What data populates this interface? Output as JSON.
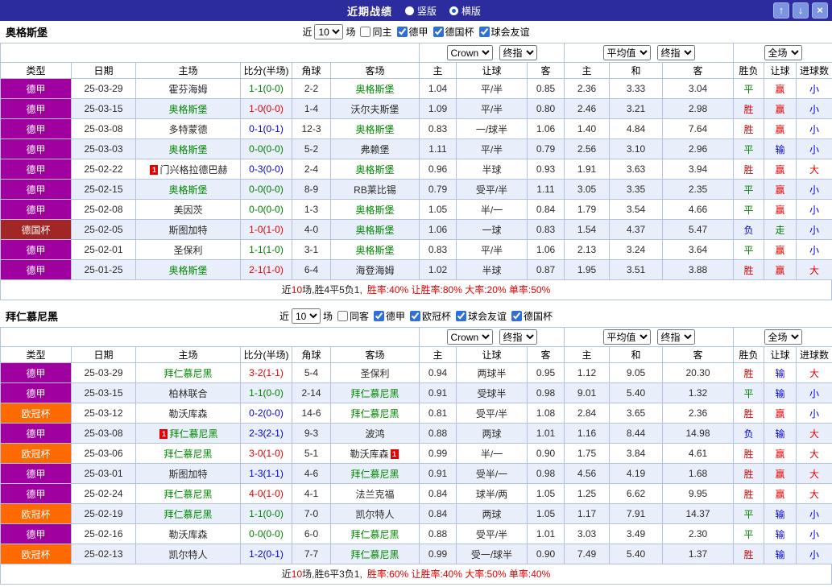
{
  "titlebar": {
    "title": "近期战绩",
    "vertical": "竖版",
    "horizontal": "横版",
    "selected": "横版",
    "up_icon": "↑",
    "down_icon": "↓",
    "close_icon": "×"
  },
  "labels": {
    "recent": "近",
    "matches": "场"
  },
  "th": {
    "type": "类型",
    "date": "日期",
    "home": "主场",
    "score": "比分(半场)",
    "corner": "角球",
    "away": "客场",
    "ah_home": "主",
    "ah_line": "让球",
    "ah_away": "客",
    "eu_home": "主",
    "eu_draw": "和",
    "eu_away": "客",
    "wdl": "胜负",
    "ah_result": "让球",
    "goals": "进球数"
  },
  "dropdowns": {
    "bookmaker": "Crown",
    "ah_index": "终指",
    "eu_source": "平均值",
    "eu_index": "终指",
    "scope": "全场"
  },
  "colors": {
    "titlebar_bg": "#2c2c9e",
    "type_bundesliga": "#a000a0",
    "type_dfb_pokal": "#a32626",
    "type_ucl": "#ff6a00",
    "win": "#e60000",
    "draw": "#008000",
    "loss": "#0000dd",
    "focus_team": "#008800",
    "accent_blue": "#2f6fd6"
  },
  "sections": [
    {
      "team": "奥格斯堡",
      "filter": {
        "count": "10",
        "venue_label": "同主",
        "venue_checked": false,
        "leagues": [
          "德甲",
          "德国杯",
          "球会友谊"
        ]
      },
      "rows": [
        {
          "type": "德甲",
          "date": "25-03-29",
          "home": "霍芬海姆",
          "score": "1-1(0-0)",
          "corner": "2-2",
          "away": "奥格斯堡",
          "ah": [
            "1.04",
            "平/半",
            "0.85"
          ],
          "eu": [
            "2.36",
            "3.33",
            "3.04"
          ],
          "wdl": "平",
          "ah_result": "赢",
          "goals": "小"
        },
        {
          "type": "德甲",
          "date": "25-03-15",
          "home": "奥格斯堡",
          "score": "1-0(0-0)",
          "corner": "1-4",
          "away": "沃尔夫斯堡",
          "ah": [
            "1.09",
            "平/半",
            "0.80"
          ],
          "eu": [
            "2.46",
            "3.21",
            "2.98"
          ],
          "wdl": "胜",
          "ah_result": "赢",
          "goals": "小"
        },
        {
          "type": "德甲",
          "date": "25-03-08",
          "home": "多特蒙德",
          "score": "0-1(0-1)",
          "corner": "12-3",
          "away": "奥格斯堡",
          "ah": [
            "0.83",
            "一/球半",
            "1.06"
          ],
          "eu": [
            "1.40",
            "4.84",
            "7.64"
          ],
          "wdl": "胜",
          "ah_result": "赢",
          "goals": "小"
        },
        {
          "type": "德甲",
          "date": "25-03-03",
          "home": "奥格斯堡",
          "score": "0-0(0-0)",
          "corner": "5-2",
          "away": "弗赖堡",
          "ah": [
            "1.11",
            "平/半",
            "0.79"
          ],
          "eu": [
            "2.56",
            "3.10",
            "2.96"
          ],
          "wdl": "平",
          "ah_result": "输",
          "goals": "小"
        },
        {
          "type": "德甲",
          "date": "25-02-22",
          "home": "门兴格拉德巴赫",
          "home_card": "1",
          "score": "0-3(0-0)",
          "corner": "2-4",
          "away": "奥格斯堡",
          "ah": [
            "0.96",
            "半球",
            "0.93"
          ],
          "eu": [
            "1.91",
            "3.63",
            "3.94"
          ],
          "wdl": "胜",
          "ah_result": "赢",
          "goals": "大"
        },
        {
          "type": "德甲",
          "date": "25-02-15",
          "home": "奥格斯堡",
          "score": "0-0(0-0)",
          "corner": "8-9",
          "away": "RB莱比锡",
          "ah": [
            "0.79",
            "受平/半",
            "1.11"
          ],
          "eu": [
            "3.05",
            "3.35",
            "2.35"
          ],
          "wdl": "平",
          "ah_result": "赢",
          "goals": "小"
        },
        {
          "type": "德甲",
          "date": "25-02-08",
          "home": "美因茨",
          "score": "0-0(0-0)",
          "corner": "1-3",
          "away": "奥格斯堡",
          "ah": [
            "1.05",
            "半/一",
            "0.84"
          ],
          "eu": [
            "1.79",
            "3.54",
            "4.66"
          ],
          "wdl": "平",
          "ah_result": "赢",
          "goals": "小"
        },
        {
          "type": "德国杯",
          "date": "25-02-05",
          "home": "斯图加特",
          "score": "1-0(1-0)",
          "corner": "4-0",
          "away": "奥格斯堡",
          "ah": [
            "1.06",
            "一球",
            "0.83"
          ],
          "eu": [
            "1.54",
            "4.37",
            "5.47"
          ],
          "wdl": "负",
          "ah_result": "走",
          "goals": "小"
        },
        {
          "type": "德甲",
          "date": "25-02-01",
          "home": "圣保利",
          "score": "1-1(1-0)",
          "corner": "3-1",
          "away": "奥格斯堡",
          "ah": [
            "0.83",
            "平/半",
            "1.06"
          ],
          "eu": [
            "2.13",
            "3.24",
            "3.64"
          ],
          "wdl": "平",
          "ah_result": "赢",
          "goals": "小"
        },
        {
          "type": "德甲",
          "date": "25-01-25",
          "home": "奥格斯堡",
          "score": "2-1(1-0)",
          "corner": "6-4",
          "away": "海登海姆",
          "ah": [
            "1.02",
            "半球",
            "0.87"
          ],
          "eu": [
            "1.95",
            "3.51",
            "3.88"
          ],
          "wdl": "胜",
          "ah_result": "赢",
          "goals": "大"
        }
      ],
      "summary": {
        "prefix": "近",
        "count": "10",
        "mid": "场,胜4平5负1,",
        "stats": "胜率:40% 让胜率:80% 大率:20% 单率:50%"
      }
    },
    {
      "team": "拜仁慕尼黑",
      "filter": {
        "count": "10",
        "venue_label": "同客",
        "venue_checked": false,
        "leagues": [
          "德甲",
          "欧冠杯",
          "球会友谊",
          "德国杯"
        ]
      },
      "rows": [
        {
          "type": "德甲",
          "date": "25-03-29",
          "home": "拜仁慕尼黑",
          "score": "3-2(1-1)",
          "corner": "5-4",
          "away": "圣保利",
          "ah": [
            "0.94",
            "两球半",
            "0.95"
          ],
          "eu": [
            "1.12",
            "9.05",
            "20.30"
          ],
          "wdl": "胜",
          "ah_result": "输",
          "goals": "大"
        },
        {
          "type": "德甲",
          "date": "25-03-15",
          "home": "柏林联合",
          "score": "1-1(0-0)",
          "corner": "2-14",
          "away": "拜仁慕尼黑",
          "ah": [
            "0.91",
            "受球半",
            "0.98"
          ],
          "eu": [
            "9.01",
            "5.40",
            "1.32"
          ],
          "wdl": "平",
          "ah_result": "输",
          "goals": "小"
        },
        {
          "type": "欧冠杯",
          "date": "25-03-12",
          "home": "勒沃库森",
          "score": "0-2(0-0)",
          "corner": "14-6",
          "away": "拜仁慕尼黑",
          "ah": [
            "0.81",
            "受平/半",
            "1.08"
          ],
          "eu": [
            "2.84",
            "3.65",
            "2.36"
          ],
          "wdl": "胜",
          "ah_result": "赢",
          "goals": "小"
        },
        {
          "type": "德甲",
          "date": "25-03-08",
          "home": "拜仁慕尼黑",
          "home_card": "1",
          "score": "2-3(2-1)",
          "corner": "9-3",
          "away": "波鸿",
          "ah": [
            "0.88",
            "两球",
            "1.01"
          ],
          "eu": [
            "1.16",
            "8.44",
            "14.98"
          ],
          "wdl": "负",
          "ah_result": "输",
          "goals": "大"
        },
        {
          "type": "欧冠杯",
          "date": "25-03-06",
          "home": "拜仁慕尼黑",
          "score": "3-0(1-0)",
          "corner": "5-1",
          "away": "勒沃库森",
          "away_card": "1",
          "ah": [
            "0.99",
            "半/一",
            "0.90"
          ],
          "eu": [
            "1.75",
            "3.84",
            "4.61"
          ],
          "wdl": "胜",
          "ah_result": "赢",
          "goals": "大"
        },
        {
          "type": "德甲",
          "date": "25-03-01",
          "home": "斯图加特",
          "score": "1-3(1-1)",
          "corner": "4-6",
          "away": "拜仁慕尼黑",
          "ah": [
            "0.91",
            "受半/一",
            "0.98"
          ],
          "eu": [
            "4.56",
            "4.19",
            "1.68"
          ],
          "wdl": "胜",
          "ah_result": "赢",
          "goals": "大"
        },
        {
          "type": "德甲",
          "date": "25-02-24",
          "home": "拜仁慕尼黑",
          "score": "4-0(1-0)",
          "corner": "4-1",
          "away": "法兰克福",
          "ah": [
            "0.84",
            "球半/两",
            "1.05"
          ],
          "eu": [
            "1.25",
            "6.62",
            "9.95"
          ],
          "wdl": "胜",
          "ah_result": "赢",
          "goals": "大"
        },
        {
          "type": "欧冠杯",
          "date": "25-02-19",
          "home": "拜仁慕尼黑",
          "score": "1-1(0-0)",
          "corner": "7-0",
          "away": "凯尔特人",
          "ah": [
            "0.84",
            "两球",
            "1.05"
          ],
          "eu": [
            "1.17",
            "7.91",
            "14.37"
          ],
          "wdl": "平",
          "ah_result": "输",
          "goals": "小"
        },
        {
          "type": "德甲",
          "date": "25-02-16",
          "home": "勒沃库森",
          "score": "0-0(0-0)",
          "corner": "6-0",
          "away": "拜仁慕尼黑",
          "ah": [
            "0.88",
            "受平/半",
            "1.01"
          ],
          "eu": [
            "3.03",
            "3.49",
            "2.30"
          ],
          "wdl": "平",
          "ah_result": "输",
          "goals": "小"
        },
        {
          "type": "欧冠杯",
          "date": "25-02-13",
          "home": "凯尔特人",
          "score": "1-2(0-1)",
          "corner": "7-7",
          "away": "拜仁慕尼黑",
          "ah": [
            "0.99",
            "受一/球半",
            "0.90"
          ],
          "eu": [
            "7.49",
            "5.40",
            "1.37"
          ],
          "wdl": "胜",
          "ah_result": "输",
          "goals": "小"
        }
      ],
      "summary": {
        "prefix": "近",
        "count": "10",
        "mid": "场,胜6平3负1,",
        "stats": "胜率:60% 让胜率:40% 大率:50% 单率:40%"
      }
    }
  ]
}
